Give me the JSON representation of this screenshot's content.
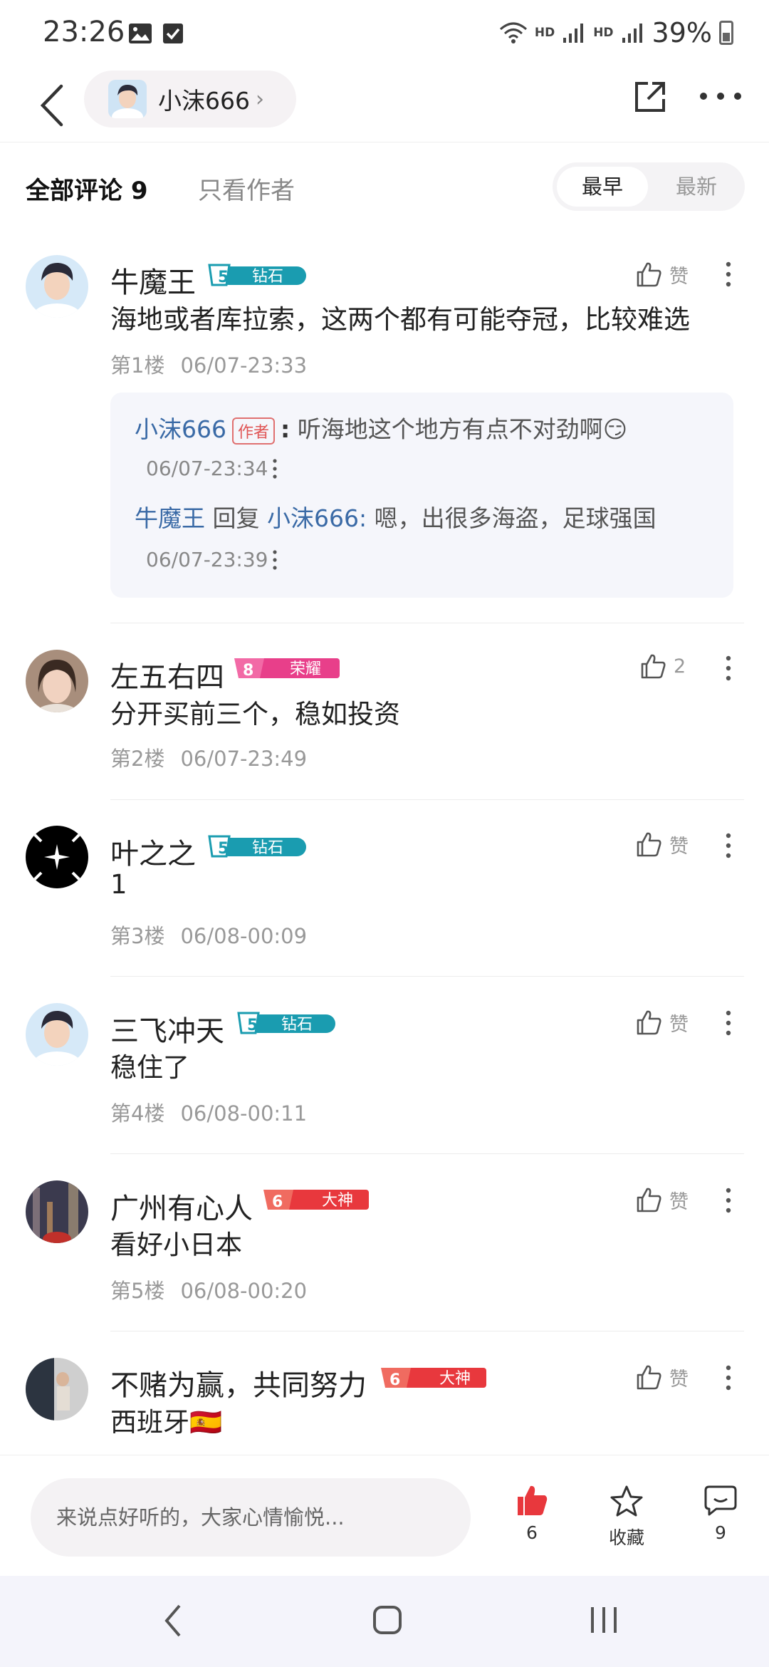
{
  "status": {
    "time": "23:26",
    "network_1": "HD",
    "network_2": "HD",
    "battery": "39%"
  },
  "header": {
    "author_name": "小沫666"
  },
  "filter": {
    "all_comments": "全部评论 9",
    "author_only": "只看作者",
    "sort_earliest": "最早",
    "sort_latest": "最新"
  },
  "comments": [
    {
      "name": "牛魔王",
      "level": "5",
      "badge": "钻石",
      "text": "海地或者库拉索，这两个都有可能夺冠，比较难选",
      "floor": "第1楼",
      "time": "06/07-23:33",
      "likes": "赞",
      "replies": [
        {
          "user": "小沫666",
          "tag": "作者",
          "separator": ":",
          "text": "听海地这个地方有点不对劲啊😏",
          "time": "06/07-23:34"
        },
        {
          "user": "牛魔王",
          "reply_word": "回复",
          "target": "小沫666:",
          "text": "嗯，出很多海盗，足球强国",
          "time": "06/07-23:39"
        }
      ]
    },
    {
      "name": "左五右四",
      "level": "8",
      "badge": "荣耀",
      "text": "分开买前三个，稳如投资",
      "floor": "第2楼",
      "time": "06/07-23:49",
      "likes": "2"
    },
    {
      "name": "叶之之",
      "level": "5",
      "badge": "钻石",
      "text": "1",
      "floor": "第3楼",
      "time": "06/08-00:09",
      "likes": "赞"
    },
    {
      "name": "三飞冲天",
      "level": "5",
      "badge": "钻石",
      "text": "稳住了",
      "floor": "第4楼",
      "time": "06/08-00:11",
      "likes": "赞"
    },
    {
      "name": "广州有心人",
      "level": "6",
      "badge": "大神",
      "text": "看好小日本",
      "floor": "第5楼",
      "time": "06/08-00:20",
      "likes": "赞"
    },
    {
      "name": "不赌为赢，共同努力",
      "level": "6",
      "badge": "大神",
      "text": "西班牙🇪🇸",
      "floor": "",
      "time": "",
      "likes": "赞"
    }
  ],
  "bottom": {
    "input_placeholder": "来说点好听的，大家心情愉悦...",
    "like_count": "6",
    "collect_label": "收藏",
    "comment_count": "9"
  },
  "colors": {
    "accent_link": "#3a6aa6",
    "badge_diamond": "#1a9cb0",
    "badge_glory": "#e83f8a",
    "badge_god": "#e8383d",
    "like_red": "#e8383d"
  }
}
